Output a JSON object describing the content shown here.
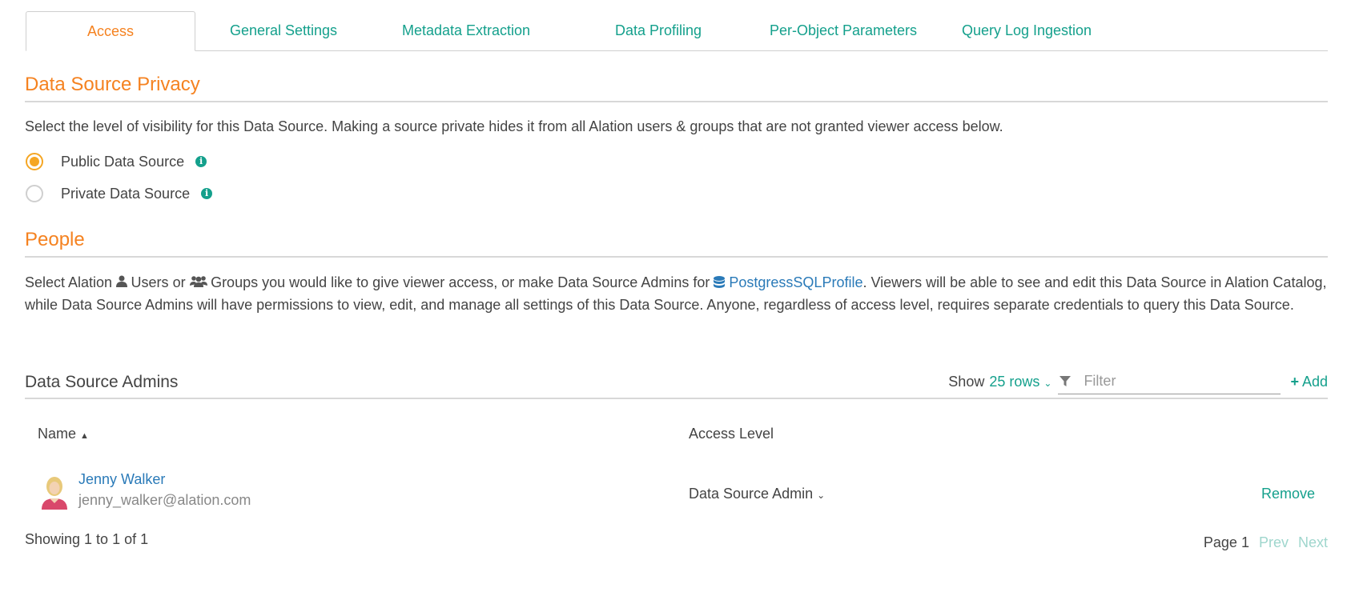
{
  "tabs": [
    {
      "label": "Access"
    },
    {
      "label": "General Settings"
    },
    {
      "label": "Metadata Extraction"
    },
    {
      "label": "Data Profiling"
    },
    {
      "label": "Per-Object Parameters"
    },
    {
      "label": "Query Log Ingestion"
    }
  ],
  "privacy": {
    "title": "Data Source Privacy",
    "description": "Select the level of visibility for this Data Source. Making a source private hides it from all Alation users & groups that are not granted viewer access below.",
    "options": [
      {
        "label": "Public Data Source",
        "checked": true
      },
      {
        "label": "Private Data Source",
        "checked": false
      }
    ]
  },
  "people": {
    "title": "People",
    "text_1": "Select Alation",
    "users_label": "Users",
    "text_or": "or",
    "groups_label": "Groups",
    "text_2": "you would like to give viewer access, or make Data Source Admins for",
    "profile_link": "PostgressSQLProfile",
    "text_3": ". Viewers will be able to see and edit this Data Source in Alation Catalog, while Data Source Admins will have permissions to view, edit, and manage all settings of this Data Source. Anyone, regardless of access level, requires separate credentials to query this Data Source."
  },
  "admins": {
    "title": "Data Source Admins",
    "show_label": "Show",
    "rows_select": "25 rows",
    "filter_placeholder": "Filter",
    "add_label": "Add",
    "columns": {
      "name": "Name",
      "access": "Access Level"
    },
    "rows": [
      {
        "name": "Jenny Walker",
        "email": "jenny_walker@alation.com",
        "access": "Data Source Admin",
        "remove_label": "Remove"
      }
    ],
    "showing": "Showing 1 to 1 of 1",
    "page_label": "Page 1",
    "prev_label": "Prev",
    "next_label": "Next"
  },
  "colors": {
    "accent_orange": "#f58220",
    "teal": "#14a08c",
    "link_blue": "#2a7ab8",
    "radio_checked": "#f5a623"
  }
}
